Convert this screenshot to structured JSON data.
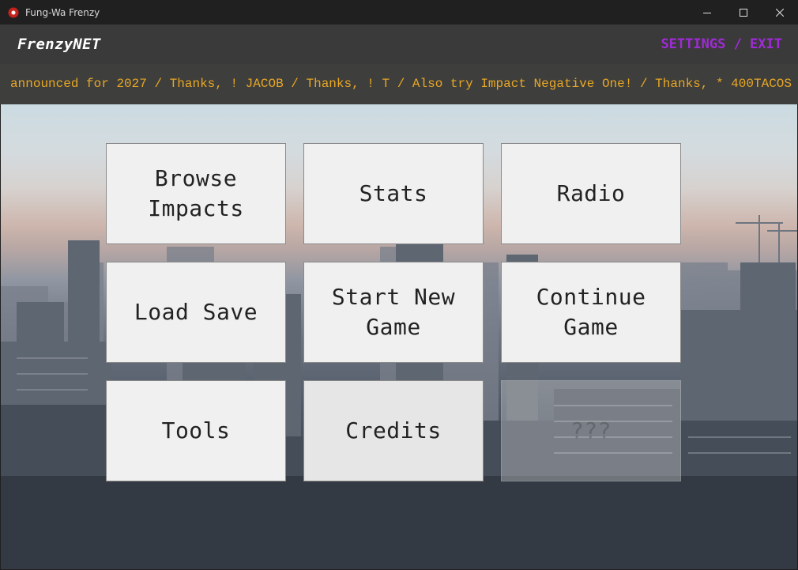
{
  "window": {
    "title": "Fung-Wa Frenzy",
    "controls": [
      "minimize-icon",
      "maximize-icon",
      "close-icon"
    ]
  },
  "header": {
    "brand": "FrenzyNET",
    "settings_label": "SETTINGS",
    "separator": " / ",
    "exit_label": "EXIT",
    "link_color": "#a02bd6"
  },
  "ticker": {
    "text": "announced for 2027 / Thanks, ! JACOB / Thanks, ! T / Also try Impact Negative One! / Thanks, * 400TACOS",
    "color": "#e9a825"
  },
  "menu": {
    "browse_impacts": "Browse\nImpacts",
    "stats": "Stats",
    "radio": "Radio",
    "load_save": "Load Save",
    "start_new_game": "Start New\nGame",
    "continue_game": "Continue\nGame",
    "tools": "Tools",
    "credits": "Credits",
    "locked": "???"
  }
}
